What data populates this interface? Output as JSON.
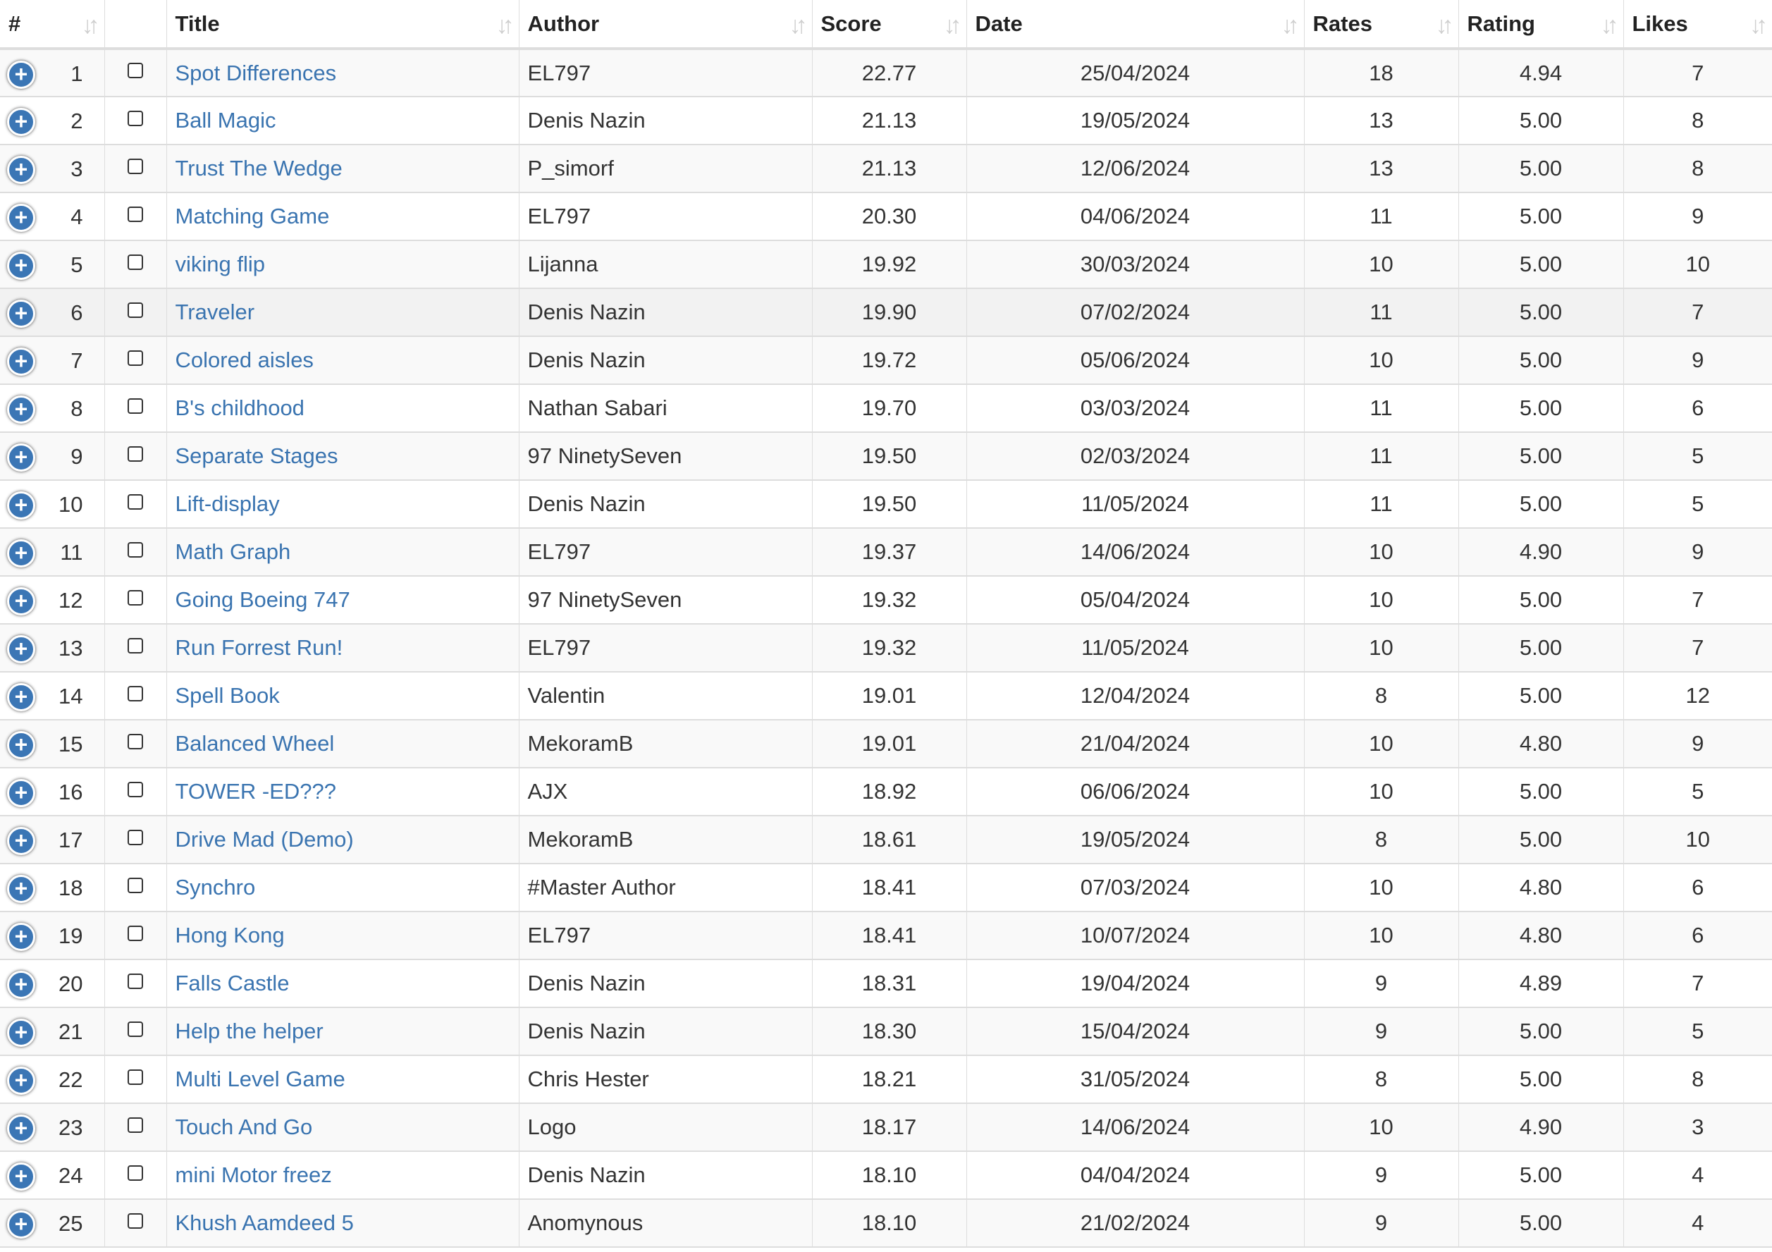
{
  "headers": {
    "num": "#",
    "title": "Title",
    "author": "Author",
    "score": "Score",
    "date": "Date",
    "rates": "Rates",
    "rating": "Rating",
    "likes": "Likes"
  },
  "icons": {
    "expand": "plus-circle-icon",
    "sort": "sort-arrows-icon",
    "select": "checkbox"
  },
  "colors": {
    "link": "#3a74b0",
    "expand_button": "#3b76b5"
  },
  "rows": [
    {
      "num": "1",
      "title": "Spot Differences",
      "author": "EL797",
      "score": "22.77",
      "date": "25/04/2024",
      "rates": "18",
      "rating": "4.94",
      "likes": "7"
    },
    {
      "num": "2",
      "title": "Ball Magic",
      "author": "Denis Nazin",
      "score": "21.13",
      "date": "19/05/2024",
      "rates": "13",
      "rating": "5.00",
      "likes": "8"
    },
    {
      "num": "3",
      "title": "Trust The Wedge",
      "author": "P_simorf",
      "score": "21.13",
      "date": "12/06/2024",
      "rates": "13",
      "rating": "5.00",
      "likes": "8"
    },
    {
      "num": "4",
      "title": "Matching Game",
      "author": "EL797",
      "score": "20.30",
      "date": "04/06/2024",
      "rates": "11",
      "rating": "5.00",
      "likes": "9"
    },
    {
      "num": "5",
      "title": "viking flip",
      "author": "Lijanna",
      "score": "19.92",
      "date": "30/03/2024",
      "rates": "10",
      "rating": "5.00",
      "likes": "10"
    },
    {
      "num": "6",
      "title": "Traveler",
      "author": "Denis Nazin",
      "score": "19.90",
      "date": "07/02/2024",
      "rates": "11",
      "rating": "5.00",
      "likes": "7"
    },
    {
      "num": "7",
      "title": "Colored aisles",
      "author": "Denis Nazin",
      "score": "19.72",
      "date": "05/06/2024",
      "rates": "10",
      "rating": "5.00",
      "likes": "9"
    },
    {
      "num": "8",
      "title": "B's childhood",
      "author": "Nathan Sabari",
      "score": "19.70",
      "date": "03/03/2024",
      "rates": "11",
      "rating": "5.00",
      "likes": "6"
    },
    {
      "num": "9",
      "title": "Separate Stages",
      "author": "97 NinetySeven",
      "score": "19.50",
      "date": "02/03/2024",
      "rates": "11",
      "rating": "5.00",
      "likes": "5"
    },
    {
      "num": "10",
      "title": "Lift-display",
      "author": "Denis Nazin",
      "score": "19.50",
      "date": "11/05/2024",
      "rates": "11",
      "rating": "5.00",
      "likes": "5"
    },
    {
      "num": "11",
      "title": "Math Graph",
      "author": "EL797",
      "score": "19.37",
      "date": "14/06/2024",
      "rates": "10",
      "rating": "4.90",
      "likes": "9"
    },
    {
      "num": "12",
      "title": "Going Boeing 747",
      "author": "97 NinetySeven",
      "score": "19.32",
      "date": "05/04/2024",
      "rates": "10",
      "rating": "5.00",
      "likes": "7"
    },
    {
      "num": "13",
      "title": "Run Forrest Run!",
      "author": "EL797",
      "score": "19.32",
      "date": "11/05/2024",
      "rates": "10",
      "rating": "5.00",
      "likes": "7"
    },
    {
      "num": "14",
      "title": "Spell Book",
      "author": "Valentin",
      "score": "19.01",
      "date": "12/04/2024",
      "rates": "8",
      "rating": "5.00",
      "likes": "12"
    },
    {
      "num": "15",
      "title": "Balanced Wheel",
      "author": "MekoramB",
      "score": "19.01",
      "date": "21/04/2024",
      "rates": "10",
      "rating": "4.80",
      "likes": "9"
    },
    {
      "num": "16",
      "title": "TOWER -ED???",
      "author": "AJX",
      "score": "18.92",
      "date": "06/06/2024",
      "rates": "10",
      "rating": "5.00",
      "likes": "5"
    },
    {
      "num": "17",
      "title": "Drive Mad (Demo)",
      "author": "MekoramB",
      "score": "18.61",
      "date": "19/05/2024",
      "rates": "8",
      "rating": "5.00",
      "likes": "10"
    },
    {
      "num": "18",
      "title": "Synchro",
      "author": "#Master Author",
      "score": "18.41",
      "date": "07/03/2024",
      "rates": "10",
      "rating": "4.80",
      "likes": "6"
    },
    {
      "num": "19",
      "title": "Hong Kong",
      "author": "EL797",
      "score": "18.41",
      "date": "10/07/2024",
      "rates": "10",
      "rating": "4.80",
      "likes": "6"
    },
    {
      "num": "20",
      "title": "Falls Castle",
      "author": "Denis Nazin",
      "score": "18.31",
      "date": "19/04/2024",
      "rates": "9",
      "rating": "4.89",
      "likes": "7"
    },
    {
      "num": "21",
      "title": "Help the helper",
      "author": "Denis Nazin",
      "score": "18.30",
      "date": "15/04/2024",
      "rates": "9",
      "rating": "5.00",
      "likes": "5"
    },
    {
      "num": "22",
      "title": "Multi Level Game",
      "author": "Chris Hester",
      "score": "18.21",
      "date": "31/05/2024",
      "rates": "8",
      "rating": "5.00",
      "likes": "8"
    },
    {
      "num": "23",
      "title": "Touch And Go",
      "author": "Logo",
      "score": "18.17",
      "date": "14/06/2024",
      "rates": "10",
      "rating": "4.90",
      "likes": "3"
    },
    {
      "num": "24",
      "title": "mini Motor freez",
      "author": "Denis Nazin",
      "score": "18.10",
      "date": "04/04/2024",
      "rates": "9",
      "rating": "5.00",
      "likes": "4"
    },
    {
      "num": "25",
      "title": "Khush Aamdeed 5",
      "author": "Anomynous",
      "score": "18.10",
      "date": "21/02/2024",
      "rates": "9",
      "rating": "5.00",
      "likes": "4"
    }
  ]
}
